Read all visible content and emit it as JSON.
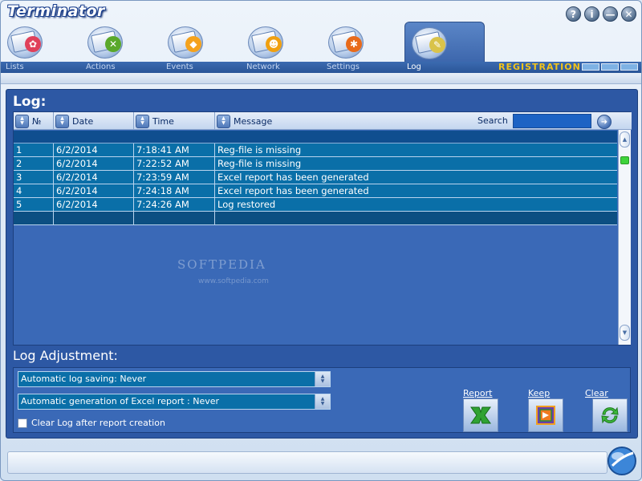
{
  "app": {
    "title": "Terminator",
    "window_buttons": [
      "?",
      "i",
      "—",
      "✕"
    ]
  },
  "toolbar": {
    "items": [
      {
        "label": "Lists",
        "icon": "lists-icon",
        "badge_color": "#e0405a",
        "badge_glyph": "✿"
      },
      {
        "label": "Actions",
        "icon": "actions-icon",
        "badge_color": "#5aa82a",
        "badge_glyph": "✕"
      },
      {
        "label": "Events",
        "icon": "events-icon",
        "badge_color": "#f5a21c",
        "badge_glyph": "◆"
      },
      {
        "label": "Network",
        "icon": "network-icon",
        "badge_color": "#f0a010",
        "badge_glyph": "☻"
      },
      {
        "label": "Settings",
        "icon": "settings-icon",
        "badge_color": "#e86a1a",
        "badge_glyph": "✱"
      },
      {
        "label": "Log",
        "icon": "log-icon",
        "badge_color": "#d9c34a",
        "badge_glyph": "✎"
      }
    ],
    "active": "Log",
    "registration_label": "REGISTRATION"
  },
  "log": {
    "title": "Log:",
    "columns": {
      "num": "№",
      "date": "Date",
      "time": "Time",
      "message": "Message"
    },
    "search": {
      "label": "Search",
      "value": ""
    },
    "rows": [
      {
        "num": "1",
        "date": "6/2/2014",
        "time": "7:18:41 AM",
        "message": "Reg-file is missing"
      },
      {
        "num": "2",
        "date": "6/2/2014",
        "time": "7:22:52 AM",
        "message": "Reg-file is missing"
      },
      {
        "num": "3",
        "date": "6/2/2014",
        "time": "7:23:59 AM",
        "message": "Excel report has been generated"
      },
      {
        "num": "4",
        "date": "6/2/2014",
        "time": "7:24:18 AM",
        "message": "Excel report has been generated"
      },
      {
        "num": "5",
        "date": "6/2/2014",
        "time": "7:24:26 AM",
        "message": "Log restored"
      }
    ]
  },
  "adjust": {
    "title": "Log Adjustment:",
    "auto_saving": "Automatic log saving: Never",
    "auto_excel": "Automatic generation of Excel report : Never",
    "clear_after_report": "Clear Log after report creation",
    "clear_after_report_checked": false,
    "actions": {
      "report": "Report",
      "keep": "Keep",
      "clear": "Clear"
    }
  },
  "watermark": {
    "text": "SOFTPEDIA",
    "sub": "www.softpedia.com"
  },
  "colors": {
    "accent": "#2d58a4",
    "row": "#0a6fa8",
    "registration": "#f3c41a"
  }
}
